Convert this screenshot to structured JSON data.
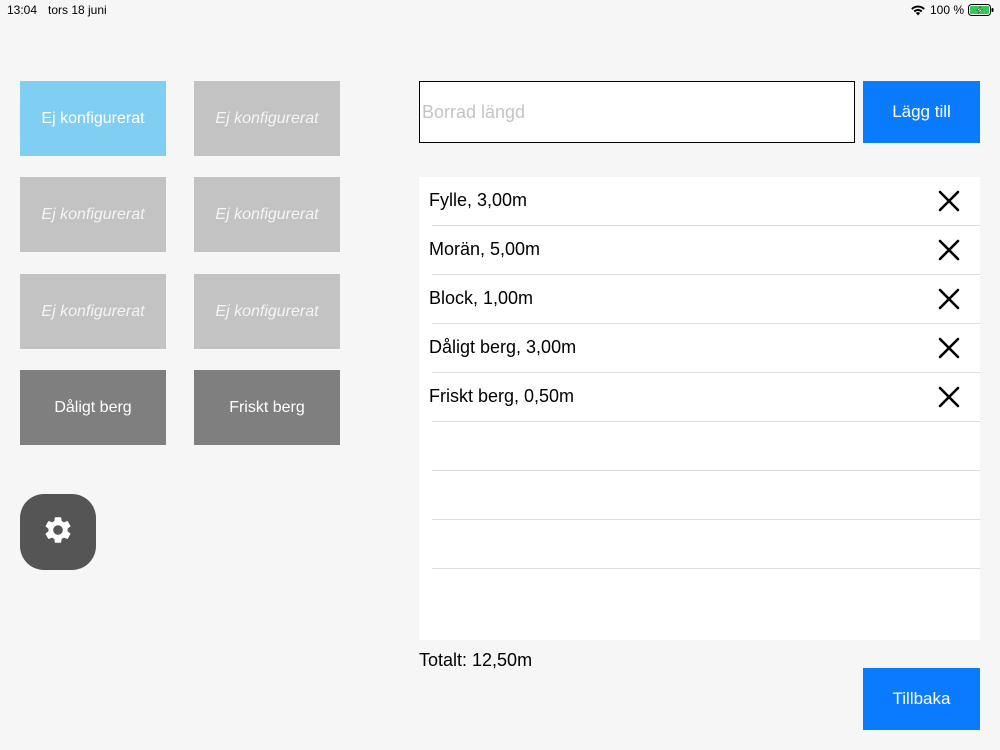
{
  "status_bar": {
    "time": "13:04",
    "date": "tors 18 juni",
    "battery_percent": "100 %",
    "battery_level": 1.0,
    "battery_color": "#34c759"
  },
  "tiles": [
    {
      "label": "Ej konfigurerat",
      "state": "selected"
    },
    {
      "label": "Ej konfigurerat",
      "state": "unconfigured"
    },
    {
      "label": "Ej konfigurerat",
      "state": "unconfigured"
    },
    {
      "label": "Ej konfigurerat",
      "state": "unconfigured"
    },
    {
      "label": "Ej konfigurerat",
      "state": "unconfigured"
    },
    {
      "label": "Ej konfigurerat",
      "state": "unconfigured"
    },
    {
      "label": "Dåligt berg",
      "state": "configured"
    },
    {
      "label": "Friskt berg",
      "state": "configured"
    }
  ],
  "settings": {
    "icon": "gear-icon"
  },
  "input": {
    "placeholder": "Borrad längd",
    "value": ""
  },
  "add_button": {
    "label": "Lägg till"
  },
  "layers": [
    {
      "label": "Fylle, 3,00m"
    },
    {
      "label": "Morän, 5,00m"
    },
    {
      "label": "Block, 1,00m"
    },
    {
      "label": "Dåligt berg, 3,00m"
    },
    {
      "label": "Friskt berg, 0,50m"
    }
  ],
  "total": {
    "label": "Totalt: 12,50m"
  },
  "back_button": {
    "label": "Tillbaka"
  },
  "colors": {
    "accent": "#0a7aff",
    "selected_tile": "#81cef3",
    "unconfigured_tile": "#c3c3c3",
    "configured_tile": "#7f7f7f",
    "settings_button": "#555555"
  }
}
